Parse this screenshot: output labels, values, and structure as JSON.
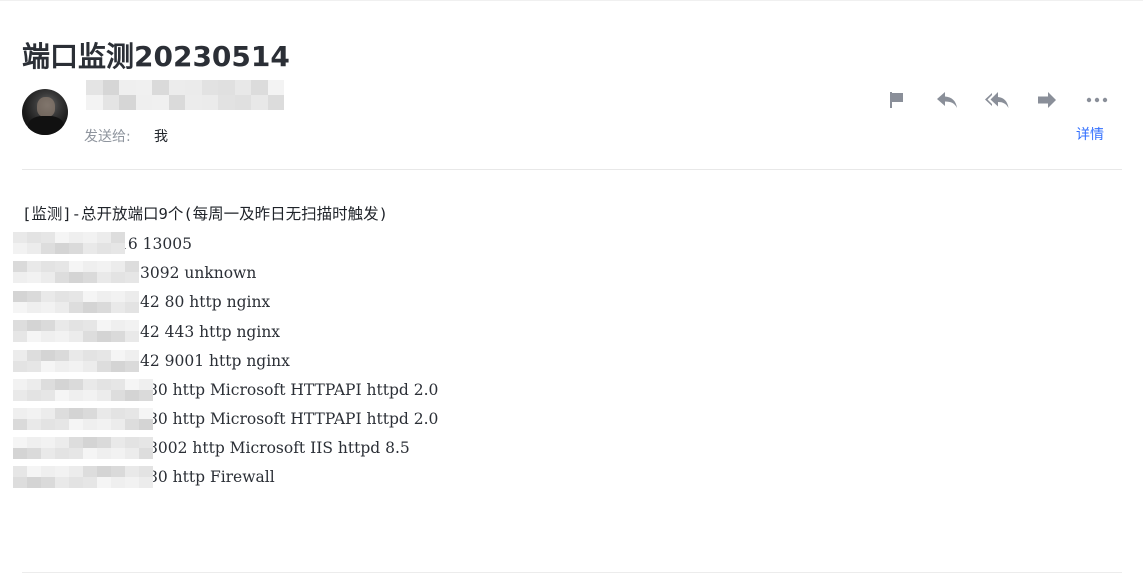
{
  "email": {
    "subject": "端口监测20230514",
    "sender_name": "",
    "sendto_label": "发送给:",
    "sendto_value": "我",
    "details_label": "详情"
  },
  "actions": [
    {
      "name": "flag-button",
      "icon": "flag-icon"
    },
    {
      "name": "reply-button",
      "icon": "reply-icon"
    },
    {
      "name": "reply-all-button",
      "icon": "reply-all-icon"
    },
    {
      "name": "forward-button",
      "icon": "forward-icon"
    },
    {
      "name": "more-button",
      "icon": "more-icon"
    }
  ],
  "body": {
    "header": "[监测]-总开放端口9个(每周一及昨日无扫描时触发)",
    "rows": [
      "16 13005",
      "3092 unknown",
      "42 80 http nginx",
      "42 443 http nginx",
      "42 9001 http nginx",
      "80 http Microsoft HTTPAPI httpd 2.0",
      "80 http Microsoft HTTPAPI httpd 2.0",
      "8002 http Microsoft IIS httpd 8.5",
      "80 http Firewall"
    ]
  },
  "colors": {
    "accent": "#3370ff",
    "icon_gray": "#8a8f99",
    "muted_text": "#8f959e"
  }
}
